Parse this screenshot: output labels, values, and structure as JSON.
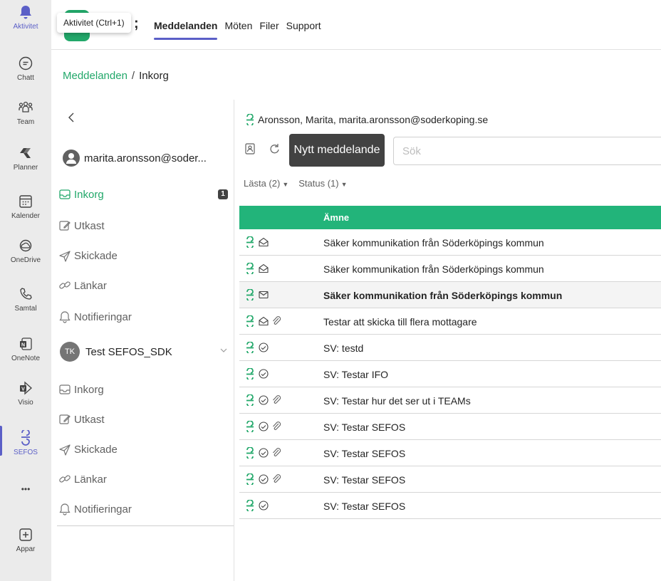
{
  "rail": {
    "items": [
      {
        "label": "Aktivitet",
        "icon": "bell-icon"
      },
      {
        "label": "Chatt",
        "icon": "chat-icon"
      },
      {
        "label": "Team",
        "icon": "team-icon"
      },
      {
        "label": "Planner",
        "icon": "planner-icon"
      },
      {
        "label": "Kalender",
        "icon": "calendar-icon"
      },
      {
        "label": "OneDrive",
        "icon": "cloud-icon"
      },
      {
        "label": "Samtal",
        "icon": "phone-icon"
      },
      {
        "label": "OneNote",
        "icon": "onenote-icon"
      },
      {
        "label": "Visio",
        "icon": "visio-icon"
      },
      {
        "label": "SEFOS",
        "icon": "sefos-icon"
      },
      {
        "label": "Appar",
        "icon": "plus-icon"
      }
    ],
    "more": "•••"
  },
  "tooltip": "Aktivitet (Ctrl+1)",
  "tabs": [
    "Meddelanden",
    "Möten",
    "Filer",
    "Support"
  ],
  "breadcrumb": {
    "root": "Meddelanden",
    "sep": "/",
    "current": "Inkorg"
  },
  "account": {
    "name": "marita.aronsson@soder..."
  },
  "folders": [
    {
      "label": "Inkorg",
      "badge": "1"
    },
    {
      "label": "Utkast"
    },
    {
      "label": "Skickade"
    },
    {
      "label": "Länkar"
    },
    {
      "label": "Notifieringar"
    }
  ],
  "group": {
    "initials": "TK",
    "name": "Test SEFOS_SDK"
  },
  "group_folders": [
    {
      "label": "Inkorg"
    },
    {
      "label": "Utkast"
    },
    {
      "label": "Skickade"
    },
    {
      "label": "Länkar"
    },
    {
      "label": "Notifieringar"
    }
  ],
  "mailbox": {
    "title": "Aronsson, Marita, marita.aronsson@soderkoping.se"
  },
  "toolbar": {
    "new_message": "Nytt meddelande",
    "search_placeholder": "Sök"
  },
  "filters": [
    {
      "label": "Lästa (2)"
    },
    {
      "label": "Status (1)"
    }
  ],
  "table": {
    "header": "Ämne",
    "rows": [
      {
        "subject": "Säker kommunikation från Söderköpings kommun",
        "status": "open-envelope",
        "attachment": false,
        "unread": false
      },
      {
        "subject": "Säker kommunikation från Söderköpings kommun",
        "status": "open-envelope",
        "attachment": false,
        "unread": false
      },
      {
        "subject": "Säker kommunikation från Söderköpings kommun",
        "status": "closed-envelope",
        "attachment": false,
        "unread": true
      },
      {
        "subject": "Testar att skicka till flera mottagare",
        "status": "open-envelope",
        "attachment": true,
        "unread": false
      },
      {
        "subject": "SV: testd",
        "status": "reply",
        "attachment": false,
        "unread": false
      },
      {
        "subject": "SV: Testar IFO",
        "status": "reply",
        "attachment": false,
        "unread": false
      },
      {
        "subject": "SV: Testar hur det ser ut i TEAMs",
        "status": "reply",
        "attachment": true,
        "unread": false
      },
      {
        "subject": "SV: Testar SEFOS",
        "status": "reply",
        "attachment": true,
        "unread": false
      },
      {
        "subject": "SV: Testar SEFOS",
        "status": "reply",
        "attachment": true,
        "unread": false
      },
      {
        "subject": "SV: Testar SEFOS",
        "status": "reply",
        "attachment": true,
        "unread": false
      },
      {
        "subject": "SV: Testar SEFOS",
        "status": "reply",
        "attachment": false,
        "unread": false
      }
    ]
  },
  "colors": {
    "accent": "#5b5fc7",
    "sefos_green": "#22a86a",
    "header_green": "#22b47a"
  }
}
